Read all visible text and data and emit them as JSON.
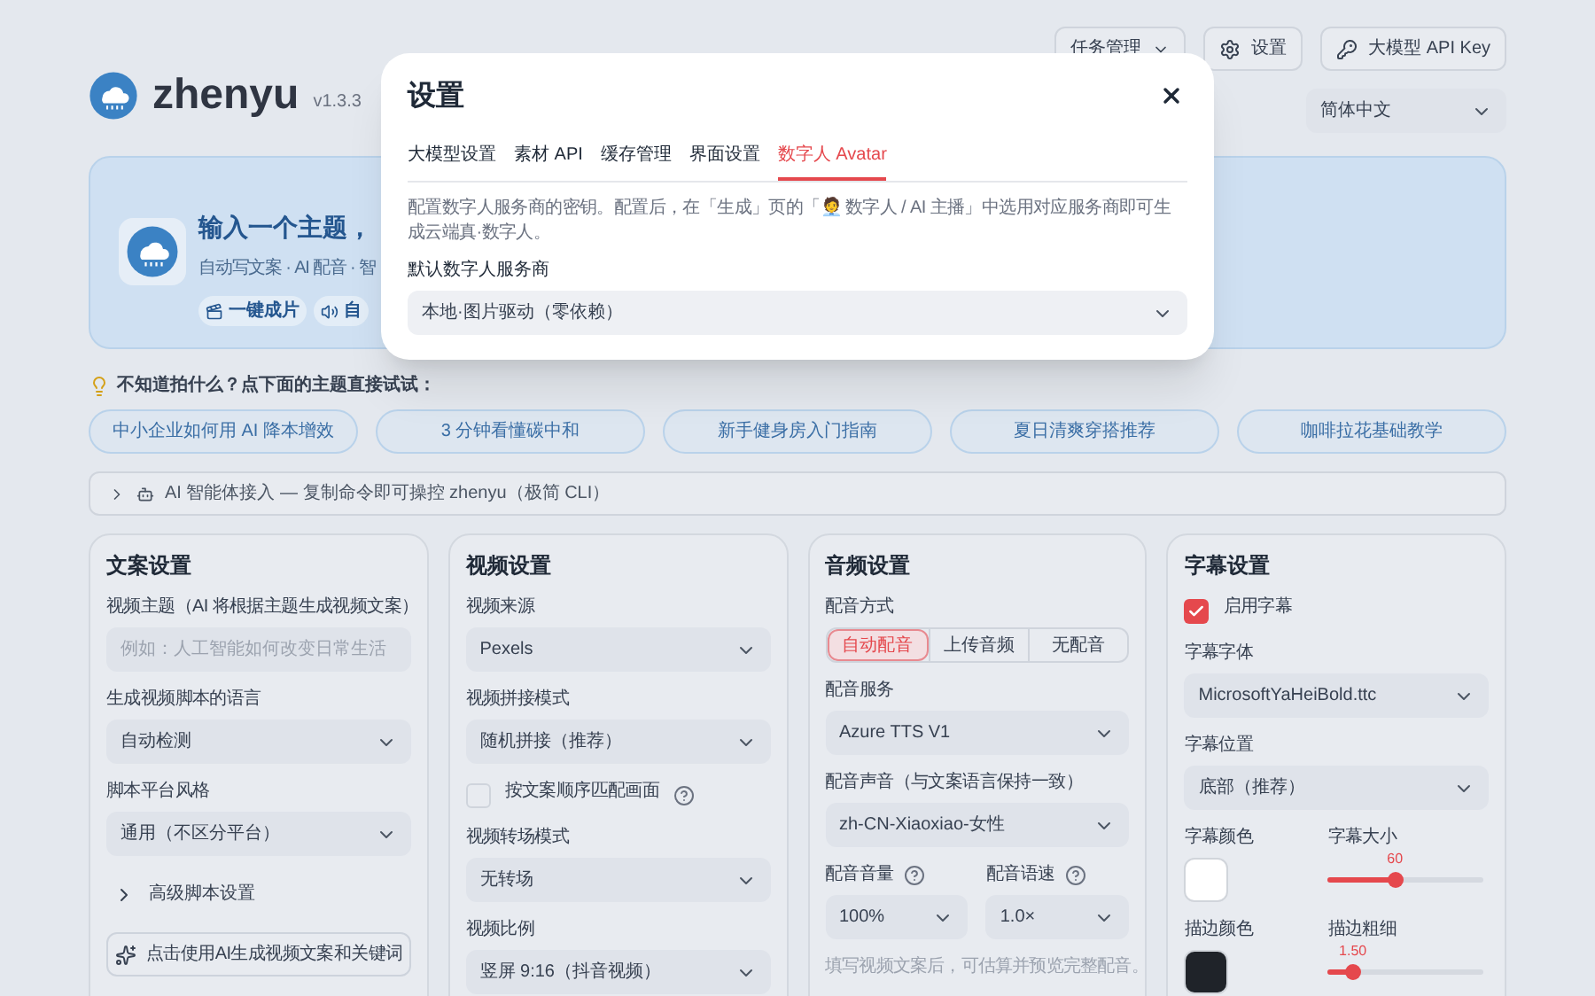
{
  "header": {
    "app_name": "zhenyu",
    "version": "v1.3.3",
    "buttons": [
      {
        "label": "任务管理",
        "kind": "dropdown"
      },
      {
        "label": "设置",
        "kind": "settings"
      },
      {
        "label": "大模型 API Key",
        "kind": "key"
      }
    ],
    "language": "简体中文"
  },
  "hero": {
    "title": "输入一个主题，",
    "subtitle": "自动写文案 · AI 配音 · 智",
    "badges": [
      {
        "label": "一键成片",
        "kind": "clapper"
      },
      {
        "label": "自",
        "kind": "speaker"
      }
    ]
  },
  "hint": "不知道拍什么？点下面的主题直接试试：",
  "topics": [
    "中小企业如何用 AI 降本增效",
    "3 分钟看懂碳中和",
    "新手健身房入门指南",
    "夏日清爽穿搭推荐",
    "咖啡拉花基础教学"
  ],
  "agent_bar": {
    "text": "AI 智能体接入 — 复制命令即可操控 zhenyu（极简 CLI）",
    "expanded": false
  },
  "panels": [
    {
      "title": "文案设置",
      "fields": [
        {
          "kind": "input",
          "label": "视频主题（AI 将根据主题生成视频文案）",
          "placeholder": "例如：人工智能如何改变日常生活"
        },
        {
          "kind": "select",
          "label": "生成视频脚本的语言",
          "value": "自动检测"
        },
        {
          "kind": "select",
          "label": "脚本平台风格",
          "value": "通用（不区分平台）"
        },
        {
          "kind": "disclosure",
          "label": "高级脚本设置",
          "expanded": false
        },
        {
          "kind": "action",
          "label": "点击使用AI生成视频文案和关键词"
        }
      ]
    },
    {
      "title": "视频设置",
      "fields": [
        {
          "kind": "select",
          "label": "视频来源",
          "value": "Pexels"
        },
        {
          "kind": "select",
          "label": "视频拼接模式",
          "value": "随机拼接（推荐）"
        },
        {
          "kind": "checkbox",
          "label": "按文案顺序匹配画面",
          "checked": false,
          "help": true
        },
        {
          "kind": "select",
          "label": "视频转场模式",
          "value": "无转场"
        },
        {
          "kind": "select",
          "label": "视频比例",
          "value": "竖屏 9:16（抖音视频）"
        }
      ]
    },
    {
      "title": "音频设置",
      "fields": [
        {
          "kind": "segmented",
          "label": "配音方式",
          "options": [
            {
              "label": "自动配音",
              "selected": true
            },
            {
              "label": "上传音频",
              "selected": false
            },
            {
              "label": "无配音",
              "selected": false
            }
          ]
        },
        {
          "kind": "select",
          "label": "配音服务",
          "value": "Azure TTS V1"
        },
        {
          "kind": "select",
          "label": "配音声音（与文案语言保持一致）",
          "value": "zh-CN-Xiaoxiao-女性"
        },
        {
          "kind": "select_pair",
          "items": [
            {
              "label": "配音音量",
              "value": "100%",
              "help": true
            },
            {
              "label": "配音语速",
              "value": "1.0×",
              "help": true
            }
          ]
        },
        {
          "kind": "note",
          "label": "填写视频文案后，可估算并预览完整配音。"
        }
      ]
    },
    {
      "title": "字幕设置",
      "fields": [
        {
          "kind": "checkbox",
          "label": "启用字幕",
          "checked": true
        },
        {
          "kind": "select",
          "label": "字幕字体",
          "value": "MicrosoftYaHeiBold.ttc"
        },
        {
          "kind": "select",
          "label": "字幕位置",
          "value": "底部（推荐）"
        },
        {
          "kind": "color_slider",
          "color_label": "字幕颜色",
          "color": "#ffffff",
          "slider_label": "字幕大小",
          "reading": "60",
          "level": 0.43
        },
        {
          "kind": "color_slider",
          "color_label": "描边颜色",
          "color": "#1f2329",
          "slider_label": "描边粗细",
          "reading": "1.50",
          "level": 0.16
        }
      ]
    }
  ],
  "modal": {
    "title": "设置",
    "tabs": [
      {
        "label": "大模型设置",
        "selected": false
      },
      {
        "label": "素材 API",
        "selected": false
      },
      {
        "label": "缓存管理",
        "selected": false
      },
      {
        "label": "界面设置",
        "selected": false
      },
      {
        "label": "数字人 Avatar",
        "selected": true
      }
    ],
    "description": "配置数字人服务商的密钥。配置后，在「生成」页的「🧑‍💼 数字人 / AI 主播」中选用对应服务商即可生成云端真·数字人。",
    "field": {
      "label": "默认数字人服务商",
      "value": "本地·图片驱动（零依赖）"
    }
  }
}
